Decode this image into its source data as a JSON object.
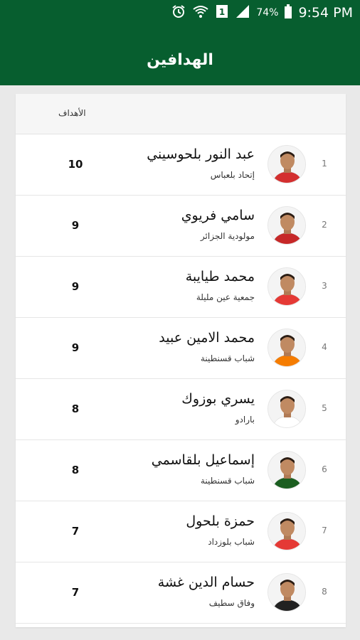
{
  "status_bar": {
    "battery": "74%",
    "time": "9:54 PM",
    "icons": [
      "alarm-icon",
      "wifi-icon",
      "sim-icon",
      "signal-icon",
      "battery-icon"
    ]
  },
  "header": {
    "title": "الهدافين"
  },
  "table": {
    "goals_column": "الأهداف",
    "rows": [
      {
        "rank": "1",
        "name": "عبد النور بلحوسيني",
        "team": "إتحاد بلعباس",
        "goals": "10",
        "kit_color": "#d32f2f"
      },
      {
        "rank": "2",
        "name": "سامي فريوي",
        "team": "مولودية الجزائر",
        "goals": "9",
        "kit_color": "#c62828"
      },
      {
        "rank": "3",
        "name": "محمد طيايبة",
        "team": "جمعية عين مليلة",
        "goals": "9",
        "kit_color": "#e53935"
      },
      {
        "rank": "4",
        "name": "محمد الامين عبيد",
        "team": "شباب قسنطينة",
        "goals": "9",
        "kit_color": "#f57c00"
      },
      {
        "rank": "5",
        "name": "يسري بوزوك",
        "team": "بارادو",
        "goals": "8",
        "kit_color": "#ffffff"
      },
      {
        "rank": "6",
        "name": "إسماعيل بلقاسمي",
        "team": "شباب قسنطينة",
        "goals": "8",
        "kit_color": "#1b5e20"
      },
      {
        "rank": "7",
        "name": "حمزة بلحول",
        "team": "شباب بلوزداد",
        "goals": "7",
        "kit_color": "#e53935"
      },
      {
        "rank": "8",
        "name": "حسام الدين غشة",
        "team": "وفاق سطيف",
        "goals": "7",
        "kit_color": "#212121"
      }
    ]
  }
}
